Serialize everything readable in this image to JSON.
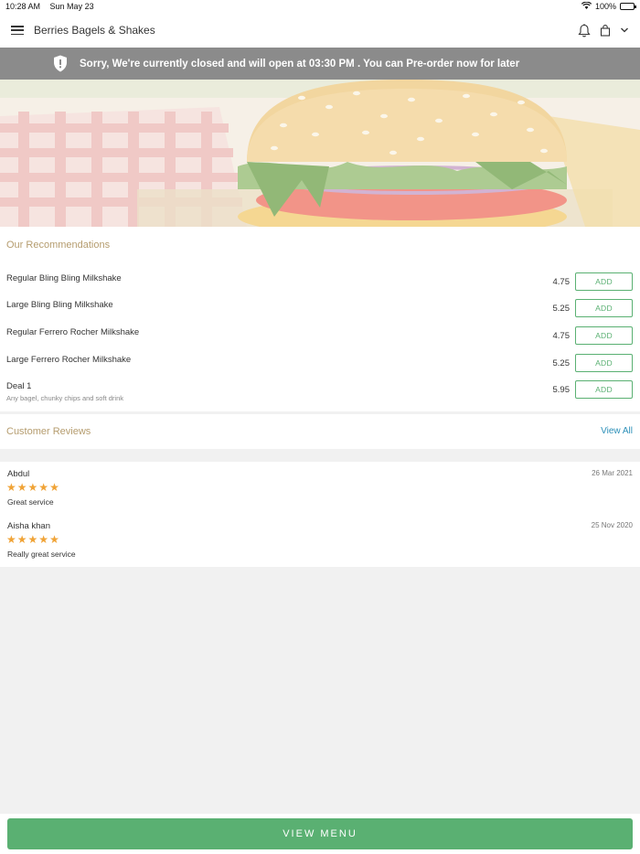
{
  "status_bar": {
    "time": "10:28 AM",
    "date": "Sun May 23",
    "battery": "100%",
    "battery_level": 1.0
  },
  "header": {
    "title": "Berries Bagels & Shakes",
    "icons": [
      "menu-icon",
      "bell-icon",
      "shopping-bag-icon",
      "chevron-down-icon"
    ]
  },
  "banner": {
    "icon": "shield-alert-icon",
    "message": "Sorry, We're currently closed and will open at 03:30 PM . You can Pre-order now for later"
  },
  "recommendations": {
    "title": "Our Recommendations",
    "items": [
      {
        "name": "Regular Bling Bling Milkshake",
        "description": "",
        "price": "4.75",
        "button": "ADD"
      },
      {
        "name": "Large Bling Bling Milkshake",
        "description": "",
        "price": "5.25",
        "button": "ADD"
      },
      {
        "name": "Regular Ferrero Rocher Milkshake",
        "description": "",
        "price": "4.75",
        "button": "ADD"
      },
      {
        "name": "Large Ferrero Rocher Milkshake",
        "description": "",
        "price": "5.25",
        "button": "ADD"
      },
      {
        "name": "Deal 1",
        "description": "Any bagel, chunky chips and soft drink",
        "price": "5.95",
        "button": "ADD"
      }
    ]
  },
  "reviews": {
    "title": "Customer Reviews",
    "view_all": "View All",
    "items": [
      {
        "name": "Abdul",
        "date": "26 Mar 2021",
        "rating": 5,
        "text": "Great service"
      },
      {
        "name": "Aisha khan",
        "date": "25 Nov 2020",
        "rating": 5,
        "text": "Really great service"
      }
    ]
  },
  "bottom": {
    "view_menu": "VIEW MENU"
  },
  "colors": {
    "accent_green": "#5ab072",
    "section_title": "#b59c6e",
    "link_blue": "#2b8fb8",
    "star": "#f0a336",
    "banner_bg": "#8b8b8b"
  }
}
